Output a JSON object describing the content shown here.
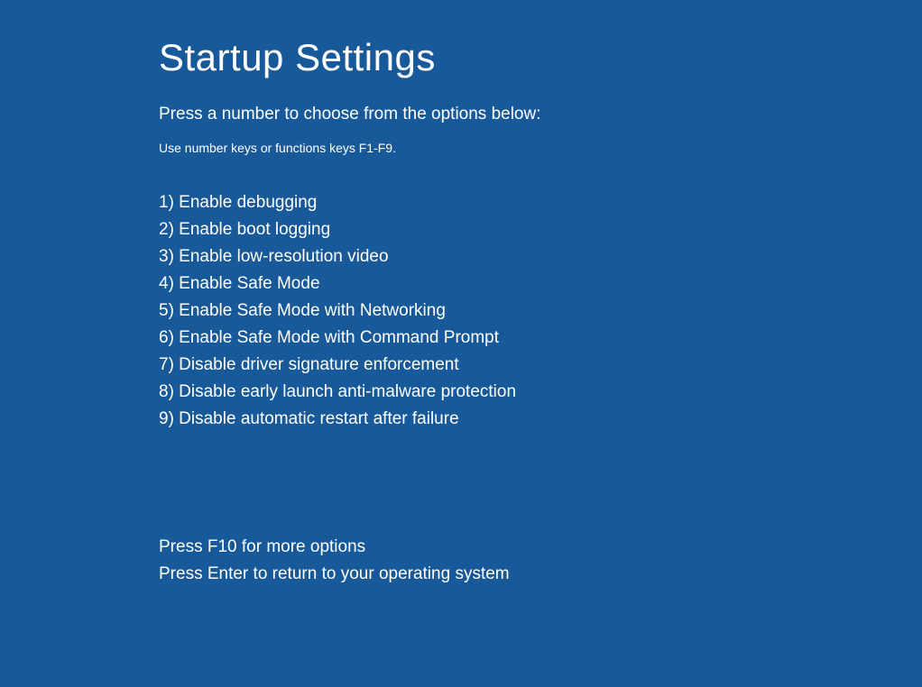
{
  "title": "Startup Settings",
  "instruction": "Press a number to choose from the options below:",
  "subinstruction": "Use number keys or functions keys F1-F9.",
  "options": [
    "1) Enable debugging",
    "2) Enable boot logging",
    "3) Enable low-resolution video",
    "4) Enable Safe Mode",
    "5) Enable Safe Mode with Networking",
    "6) Enable Safe Mode with Command Prompt",
    "7) Disable driver signature enforcement",
    "8) Disable early launch anti-malware protection",
    "9) Disable automatic restart after failure"
  ],
  "footer": {
    "more_options": "Press F10 for more options",
    "return_os": "Press Enter to return to your operating system"
  }
}
